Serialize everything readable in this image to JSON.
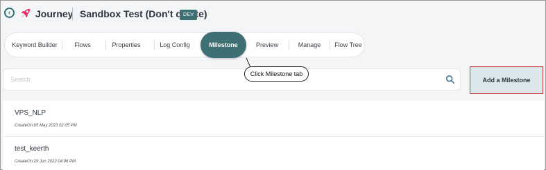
{
  "header": {
    "app_name": "Journey",
    "project_title": "Sandbox Test (Don't delete)",
    "env_badge": "DEV"
  },
  "tabs": [
    {
      "label": "Keyword Builder"
    },
    {
      "label": "Flows"
    },
    {
      "label": "Properties"
    },
    {
      "label": "Log Config"
    },
    {
      "label": "Milestone",
      "active": true
    },
    {
      "label": "Preview"
    },
    {
      "label": "Manage"
    },
    {
      "label": "Flow Tree"
    }
  ],
  "callout": {
    "text": "Click Milestone tab"
  },
  "search": {
    "placeholder": "Search"
  },
  "add_button": {
    "label": "Add a Milestone"
  },
  "milestones": [
    {
      "name": "VPS_NLP",
      "created": "CreateOn:05 May 2023 02:05 PM"
    },
    {
      "name": "test_keerth",
      "created": "CreateOn:29 Jun 2022 04:06 PM"
    }
  ],
  "colors": {
    "accent": "#3d6f73",
    "rocket": "#e2336b",
    "highlight_border": "#c9373a"
  },
  "icons": {
    "back": "circle-chevron-left-icon",
    "logo": "rocket-icon",
    "search": "search-icon"
  }
}
